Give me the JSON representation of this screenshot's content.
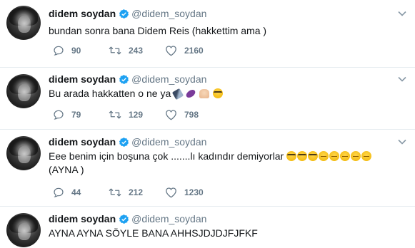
{
  "user": {
    "name": "didem soydan",
    "handle": "@didem_soydan"
  },
  "tweets": [
    {
      "text": "bundan sonra bana Didem Reis (hakkettim ama )",
      "emoji_icons": [],
      "replies": "90",
      "retweets": "243",
      "likes": "2160"
    },
    {
      "text": "Bu arada hakkatten o ne ya",
      "emoji_icons": [
        "flashlight-emoji-icon",
        "eggplant-emoji-icon",
        "folded-hands-emoji-icon",
        "nerd-face-emoji-icon"
      ],
      "replies": "79",
      "retweets": "129",
      "likes": "798"
    },
    {
      "text": "Eee benim için boşuna çok .......lı kadındır demiyorlar",
      "text2": "(AYNA )",
      "emoji_icons": [
        "nerd-face-emoji-icon",
        "nerd-face-emoji-icon",
        "nerd-face-emoji-icon",
        "relieved-face-emoji-icon",
        "relieved-face-emoji-icon",
        "relieved-face-emoji-icon",
        "relieved-face-emoji-icon",
        "relieved-face-emoji-icon"
      ],
      "replies": "44",
      "retweets": "212",
      "likes": "1230"
    },
    {
      "text": "AYNA AYNA SÖYLE BANA AHHSJDJDJFJFKF"
    }
  ],
  "colors": {
    "verified_blue": "#1da1f2",
    "name_text": "#14171a",
    "secondary_text": "#657786",
    "divider": "#e6ecf0"
  }
}
